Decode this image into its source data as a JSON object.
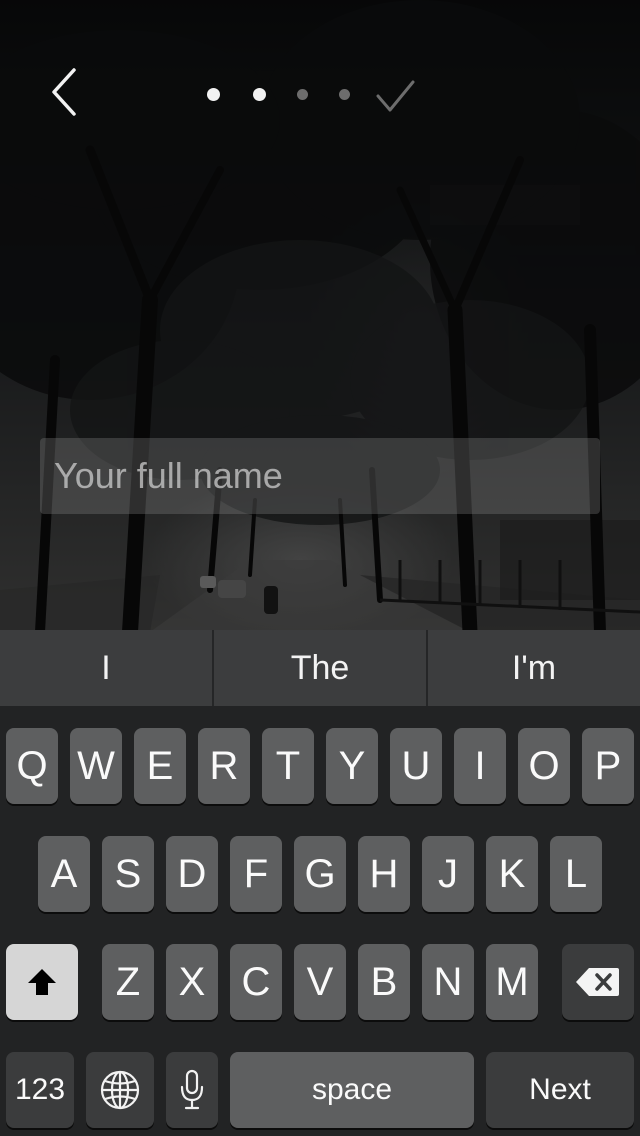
{
  "nav": {
    "back_icon": "chevron-left-icon",
    "steps_total": 4,
    "steps_completed": 2,
    "done_icon": "checkmark-icon"
  },
  "form": {
    "name_placeholder": "Your full name",
    "name_value": ""
  },
  "suggestions": [
    "I",
    "The",
    "I'm"
  ],
  "keyboard": {
    "row1": [
      "Q",
      "W",
      "E",
      "R",
      "T",
      "Y",
      "U",
      "I",
      "O",
      "P"
    ],
    "row2": [
      "A",
      "S",
      "D",
      "F",
      "G",
      "H",
      "J",
      "K",
      "L"
    ],
    "row3": [
      "Z",
      "X",
      "C",
      "V",
      "B",
      "N",
      "M"
    ],
    "shift_icon": "shift-arrow-icon",
    "delete_icon": "backspace-icon",
    "numbers_label": "123",
    "globe_icon": "globe-icon",
    "mic_icon": "microphone-icon",
    "space_label": "space",
    "return_label": "Next"
  },
  "colors": {
    "key": "#5e5f60",
    "key_dark": "#3b3c3d",
    "shift_active": "#d6d6d6",
    "keyboard_bg": "#222324",
    "suggestion_bg": "#3c3d3e"
  }
}
